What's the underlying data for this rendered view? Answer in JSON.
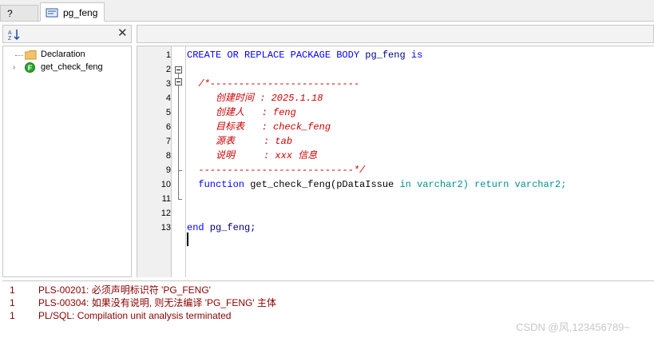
{
  "tabs": {
    "unsaved_label": "?",
    "active_label": "pg_feng"
  },
  "tree": {
    "items": [
      {
        "label": "Declaration"
      },
      {
        "label": "get_check_feng",
        "icon_letter": "F"
      }
    ]
  },
  "editor": {
    "line_numbers": [
      "1",
      "2",
      "3",
      "4",
      "5",
      "6",
      "7",
      "8",
      "9",
      "10",
      "11",
      "12",
      "13"
    ],
    "lines": {
      "l1": {
        "kw1": "CREATE OR REPLACE PACKAGE BODY",
        "name": "pg_feng",
        "kw2": "is"
      },
      "l3": "  /*--------------------------",
      "l4": "     创建时间 : 2025.1.18",
      "l5": "     创建人   : feng",
      "l6": "     目标表   : check_feng",
      "l7": "     源表     : tab",
      "l8": "     说明     : xxx 信息",
      "l9": "  ---------------------------*/",
      "l10": {
        "kw": "  function",
        "name": " get_check_feng(pDataIssue ",
        "in": "in",
        "t1": " varchar2)",
        "ret": " return",
        "t2": " varchar2;"
      },
      "l13": {
        "kw": "end",
        "name": " pg_feng;"
      }
    }
  },
  "messages": [
    {
      "line": "1",
      "text": "PLS-00201: 必须声明标识符 'PG_FENG'"
    },
    {
      "line": "1",
      "text": "PLS-00304: 如果没有说明, 则无法编译 'PG_FENG' 主体"
    },
    {
      "line": "1",
      "text": "PL/SQL: Compilation unit analysis terminated"
    }
  ],
  "watermark": "CSDN @风,123456789~",
  "colors": {
    "keyword": "#0000ff",
    "comment": "#cc0000",
    "error_text": "#8b0000"
  }
}
